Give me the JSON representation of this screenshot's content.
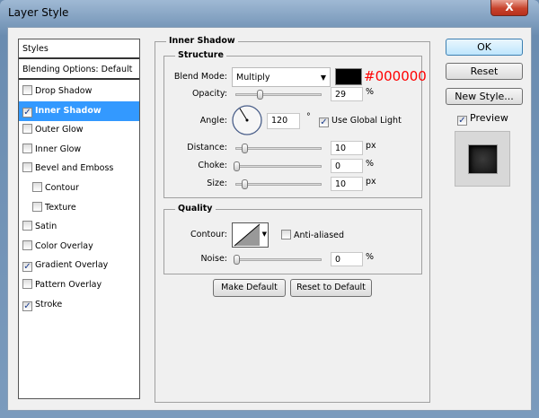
{
  "window": {
    "title": "Layer Style",
    "close_label": "X"
  },
  "sidebar": {
    "header": "Styles",
    "blending": "Blending Options: Default",
    "items": [
      {
        "label": "Drop Shadow",
        "checked": false,
        "indent": false
      },
      {
        "label": "Inner Shadow",
        "checked": true,
        "indent": false,
        "selected": true
      },
      {
        "label": "Outer Glow",
        "checked": false,
        "indent": false
      },
      {
        "label": "Inner Glow",
        "checked": false,
        "indent": false
      },
      {
        "label": "Bevel and Emboss",
        "checked": false,
        "indent": false
      },
      {
        "label": "Contour",
        "checked": false,
        "indent": true
      },
      {
        "label": "Texture",
        "checked": false,
        "indent": true
      },
      {
        "label": "Satin",
        "checked": false,
        "indent": false
      },
      {
        "label": "Color Overlay",
        "checked": false,
        "indent": false
      },
      {
        "label": "Gradient Overlay",
        "checked": true,
        "indent": false
      },
      {
        "label": "Pattern Overlay",
        "checked": false,
        "indent": false
      },
      {
        "label": "Stroke",
        "checked": true,
        "indent": false
      }
    ]
  },
  "panel": {
    "title": "Inner Shadow",
    "structure": {
      "title": "Structure",
      "blend_label": "Blend Mode:",
      "blend_value": "Multiply",
      "color": "#000000",
      "color_label": "#000000",
      "opacity_label": "Opacity:",
      "opacity": "29",
      "opacity_unit": "%",
      "angle_label": "Angle:",
      "angle": "120",
      "angle_unit": "°",
      "global_light_label": "Use Global Light",
      "global_light": true,
      "distance_label": "Distance:",
      "distance": "10",
      "distance_unit": "px",
      "choke_label": "Choke:",
      "choke": "0",
      "choke_unit": "%",
      "size_label": "Size:",
      "size": "10",
      "size_unit": "px"
    },
    "quality": {
      "title": "Quality",
      "contour_label": "Contour:",
      "anti_aliased_label": "Anti-aliased",
      "anti_aliased": false,
      "noise_label": "Noise:",
      "noise": "0",
      "noise_unit": "%"
    },
    "make_default": "Make Default",
    "reset_default": "Reset to Default"
  },
  "buttons": {
    "ok": "OK",
    "reset": "Reset",
    "new_style": "New Style...",
    "preview": "Preview",
    "preview_checked": true
  }
}
